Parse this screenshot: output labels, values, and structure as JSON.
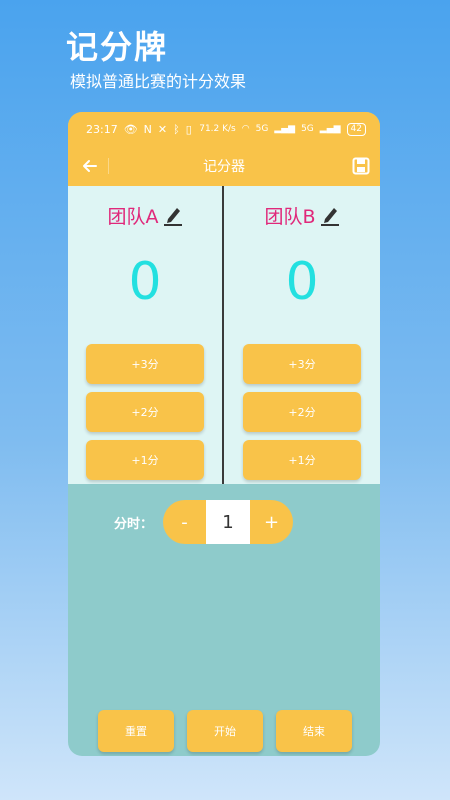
{
  "promo": {
    "title": "记分牌",
    "subtitle": "模拟普通比赛的计分效果"
  },
  "status_bar": {
    "time": "23:17",
    "left_icons": [
      "eye-icon",
      "nfc-icon",
      "mute-icon",
      "bluetooth-icon",
      "vibrate-icon"
    ],
    "right_icons": [
      "wifi-icon",
      "signal-icon",
      "signal-icon"
    ],
    "speed": "71.2 K/s",
    "network_1": "5G",
    "network_2": "5G",
    "battery": "42"
  },
  "app_bar": {
    "title": "记分器",
    "back_icon": "arrow-left-icon",
    "save_icon": "save-icon"
  },
  "teams": [
    {
      "name": "团队A",
      "score": "0",
      "buttons": [
        "+3分",
        "+2分",
        "+1分"
      ]
    },
    {
      "name": "团队B",
      "score": "0",
      "buttons": [
        "+3分",
        "+2分",
        "+1分"
      ]
    }
  ],
  "period": {
    "label": "分时：",
    "decrement": "-",
    "value": "1",
    "increment": "+"
  },
  "bottom": {
    "reset": "重置",
    "start": "开始",
    "end": "结束"
  },
  "colors": {
    "accent": "#f9c349",
    "team_name": "#e0287a",
    "score": "#23e0e0",
    "panel_bg": "#def5f4",
    "lower_bg": "#8ecbcb"
  }
}
